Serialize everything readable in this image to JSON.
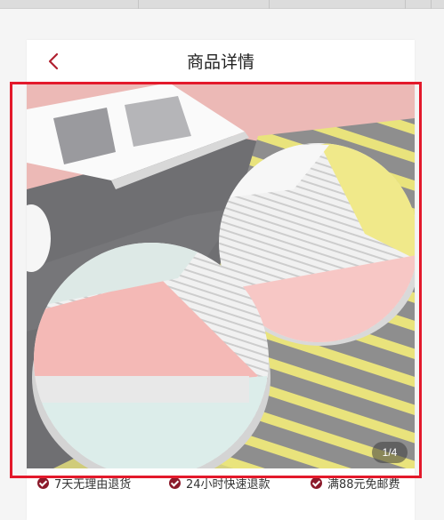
{
  "header": {
    "title": "商品详情",
    "back_icon": "chevron-left-icon",
    "back_color": "#b0202f"
  },
  "gallery": {
    "current": 1,
    "total": 4,
    "counter_text": "1/4"
  },
  "promises": [
    {
      "label": "7天无理由退货",
      "icon": "check-circle-icon"
    },
    {
      "label": "24小时快速退款",
      "icon": "check-circle-icon"
    },
    {
      "label": "满88元免邮费",
      "icon": "check-circle-icon"
    }
  ],
  "colors": {
    "accent": "#b0202f",
    "highlight_border": "#e3192b",
    "check_badge": "#8b1a2b"
  }
}
